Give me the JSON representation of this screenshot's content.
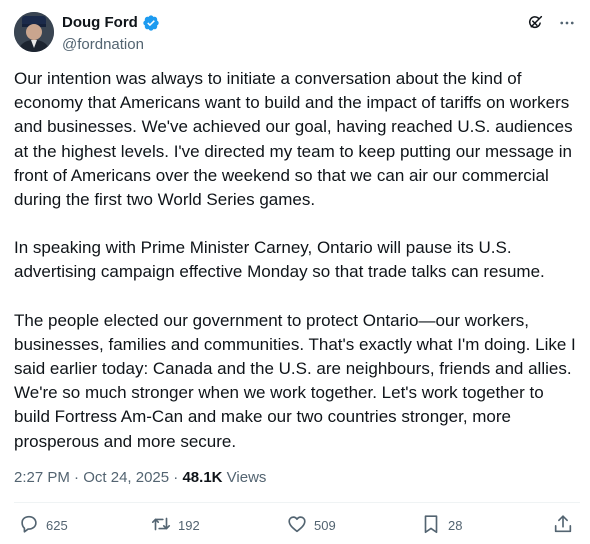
{
  "author": {
    "display_name": "Doug Ford",
    "handle": "@fordnation"
  },
  "paragraphs": [
    "Our intention was always to initiate a conversation about the kind of economy that Americans want to build and the impact of tariffs on workers and businesses. We've achieved our goal, having reached U.S. audiences at the highest levels. I've directed my team to keep putting our message in front of Americans over the weekend so that we can air our commercial during the first two World Series games.",
    "In speaking with Prime Minister Carney, Ontario will pause its U.S. advertising campaign effective Monday so that trade talks can resume.",
    "The people elected our government to protect Ontario—our workers, businesses, families and communities. That's exactly what I'm doing. Like I said earlier today: Canada and the U.S. are neighbours, friends and allies. We're so much stronger when we work together. Let's work together to build Fortress Am-Can and make our two countries stronger, more prosperous and more secure."
  ],
  "meta": {
    "time": "2:27 PM",
    "separator": "·",
    "date": "Oct 24, 2025",
    "views_count": "48.1K",
    "views_label": "Views"
  },
  "actions": {
    "replies": "625",
    "reposts": "192",
    "likes": "509",
    "bookmarks": "28"
  },
  "icons": {
    "verified": "verified-badge-icon",
    "grok": "grok-icon",
    "more": "more-icon",
    "reply": "reply-icon",
    "repost": "repost-icon",
    "like": "heart-icon",
    "bookmark": "bookmark-icon",
    "share": "share-icon"
  },
  "colors": {
    "text": "#0f1419",
    "secondary": "#536471",
    "verified": "#1d9bf0",
    "divider": "#eff3f4"
  }
}
